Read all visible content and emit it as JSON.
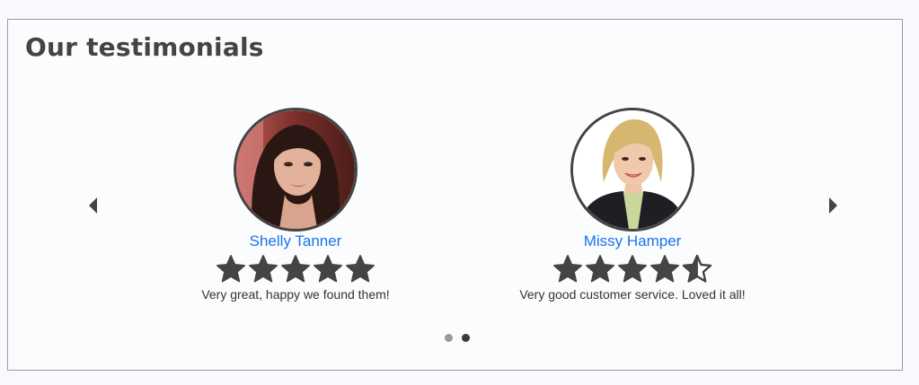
{
  "section": {
    "title": "Our testimonials"
  },
  "carousel": {
    "prev_icon": "caret-left-icon",
    "next_icon": "caret-right-icon",
    "active_page": 2,
    "total_pages": 2
  },
  "testimonials": [
    {
      "name": "Shelly Tanner",
      "rating": 5,
      "max_rating": 5,
      "quote": "Very great, happy we found them!"
    },
    {
      "name": "Missy Hamper",
      "rating": 4.5,
      "max_rating": 5,
      "quote": "Very good customer service. Loved it all!"
    }
  ],
  "colors": {
    "name_link": "#1a73e8",
    "star": "#444444",
    "heading": "#444444"
  }
}
